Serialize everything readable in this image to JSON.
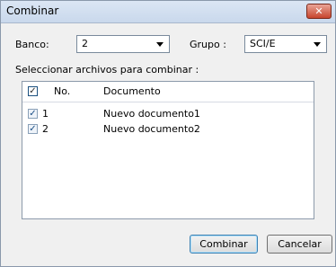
{
  "window": {
    "title": "Combinar",
    "close_glyph": "✕"
  },
  "banco": {
    "label": "Banco:",
    "value": "2"
  },
  "grupo": {
    "label": "Grupo :",
    "value": "SCI/E"
  },
  "list": {
    "caption": "Seleccionar archivos para combinar :",
    "header": {
      "checked": true,
      "col_no": "No.",
      "col_documento": "Documento"
    },
    "rows": [
      {
        "checked": true,
        "no": "1",
        "documento": "Nuevo documento1"
      },
      {
        "checked": true,
        "no": "2",
        "documento": "Nuevo documento2"
      }
    ]
  },
  "buttons": {
    "combinar": "Combinar",
    "cancelar": "Cancelar"
  },
  "glyphs": {
    "check": "✓"
  }
}
